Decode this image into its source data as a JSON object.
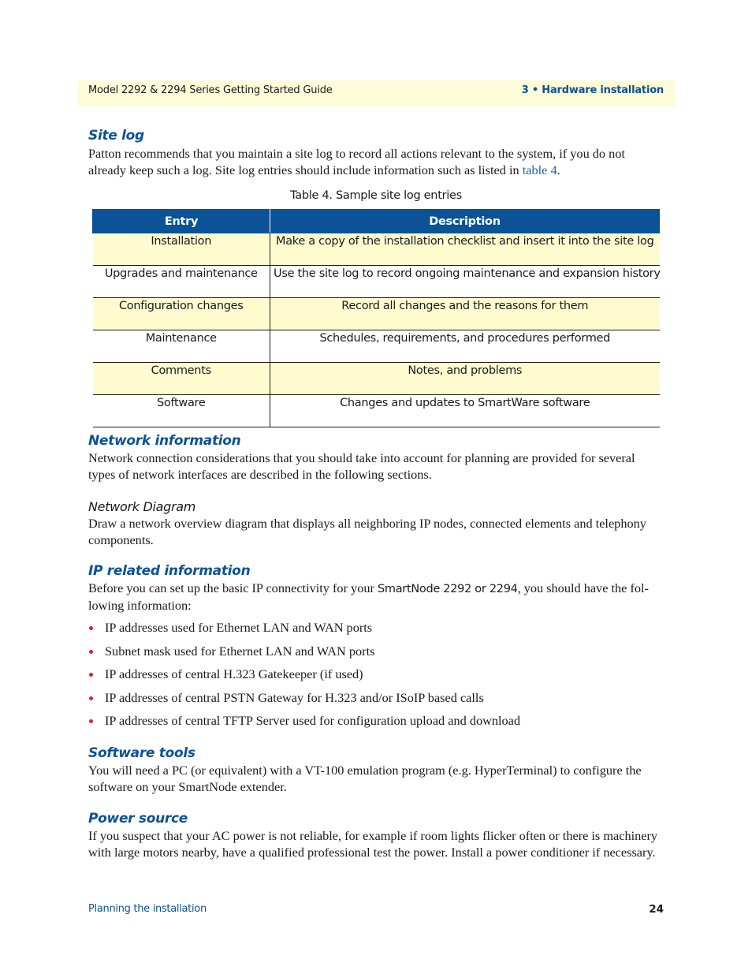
{
  "header": {
    "guide_title": "Model 2292 & 2294 Series Getting Started Guide",
    "chapter": "3 • Hardware installation"
  },
  "site_log": {
    "heading": "Site log",
    "para_before_link": "Patton recommends that you maintain a site log to record all actions relevant to the system, if you do not already keep such a log. Site log entries should include information such as listed in ",
    "link_text": "table 4",
    "para_after_link": ".",
    "table_caption": "Table 4. Sample site log entries",
    "table": {
      "columns": [
        "Entry",
        "Description"
      ],
      "rows": [
        {
          "entry": "Installation",
          "description": "Make a copy of the installation checklist and insert it into the site log"
        },
        {
          "entry": "Upgrades and maintenance",
          "description": "Use the site log to record ongoing maintenance and expansion history"
        },
        {
          "entry": "Configuration changes",
          "description": "Record all changes and the reasons for them"
        },
        {
          "entry": "Maintenance",
          "description": "Schedules, requirements, and procedures performed"
        },
        {
          "entry": "Comments",
          "description": "Notes, and problems"
        },
        {
          "entry": "Software",
          "description": "Changes and updates to SmartWare software"
        }
      ]
    }
  },
  "network_information": {
    "heading": "Network information",
    "paragraph": "Network connection considerations that you should take into account for planning are provided for several types of network interfaces are described in the following sections.",
    "subheading": "Network Diagram",
    "sub_paragraph": "Draw a network overview diagram that displays all neighboring IP nodes, connected elements and telephony components."
  },
  "ip_related": {
    "heading": "IP related information",
    "para_start": "Before you can set up the basic IP connectivity for your ",
    "product_name": "SmartNode 2292 or 2294",
    "para_end": ", you should have the fol-lowing information:",
    "bullets": [
      "IP addresses used for Ethernet LAN and WAN ports",
      "Subnet mask used for Ethernet LAN and WAN ports",
      "IP addresses of central H.323 Gatekeeper (if used)",
      "IP addresses of central PSTN Gateway for H.323 and/or ISoIP based calls",
      "IP addresses of central TFTP Server used for configuration upload and download"
    ]
  },
  "software_tools": {
    "heading": "Software tools",
    "paragraph": "You will need a PC (or equivalent) with a VT-100 emulation program (e.g. HyperTerminal) to configure the software on your SmartNode extender."
  },
  "power_source": {
    "heading": "Power source",
    "paragraph": "If you suspect that your AC power is not reliable, for example if room lights flicker often or there is machinery with large motors nearby, have a qualified professional test the power. Install a power conditioner if necessary."
  },
  "footer": {
    "section_name": "Planning the installation",
    "page_number": "24"
  }
}
